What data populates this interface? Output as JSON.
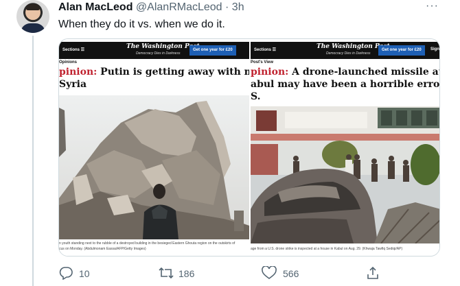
{
  "tweet": {
    "author_name": "Alan MacLeod",
    "handle": "@AlanRMacLeod",
    "separator": "·",
    "time": "3h",
    "text": "When they do it vs. when we do it.",
    "more_icon": "more-icon"
  },
  "media": {
    "left": {
      "sections": "Sections ☰",
      "logo": "The Washington Post",
      "tagline": "Democracy Dies in Darkness",
      "subscribe": "Get one year for £20",
      "kicker": "Opinions",
      "headline_prefix": "pinion:",
      "headline_line1": " Putin is getting away with murder",
      "headline_line2": "Syria",
      "caption_line1": "n youth standing next to the rubble of a destroyed building in the besieged Eastern Ghouta region on the outskirts of",
      "caption_line2": "cus on Monday. (Abdulmonam Eassa/AFP/Getty Images)"
    },
    "right": {
      "sections": "Sections ☰",
      "logo": "The Washington Post",
      "tagline": "Democracy Dies in Darkness",
      "subscribe": "Get one year for £20",
      "sign": "Sign",
      "kicker": "Post's View",
      "headline_prefix": "pinion:",
      "headline_line1": " A drone-launched missile attack in",
      "headline_line2": "abul may have been a horrible error by the",
      "headline_line3": "S.",
      "caption": "age from a U.S. drone strike is inspected at a house in Kabul on Aug. 29. (Khwaja Tawfiq Sediqi/AP)"
    }
  },
  "actions": {
    "reply_count": "10",
    "retweet_count": "186",
    "like_count": "566"
  },
  "colors": {
    "accent_red": "#c0222f",
    "subscribe_blue": "#1e5fb4",
    "muted": "#536471"
  }
}
